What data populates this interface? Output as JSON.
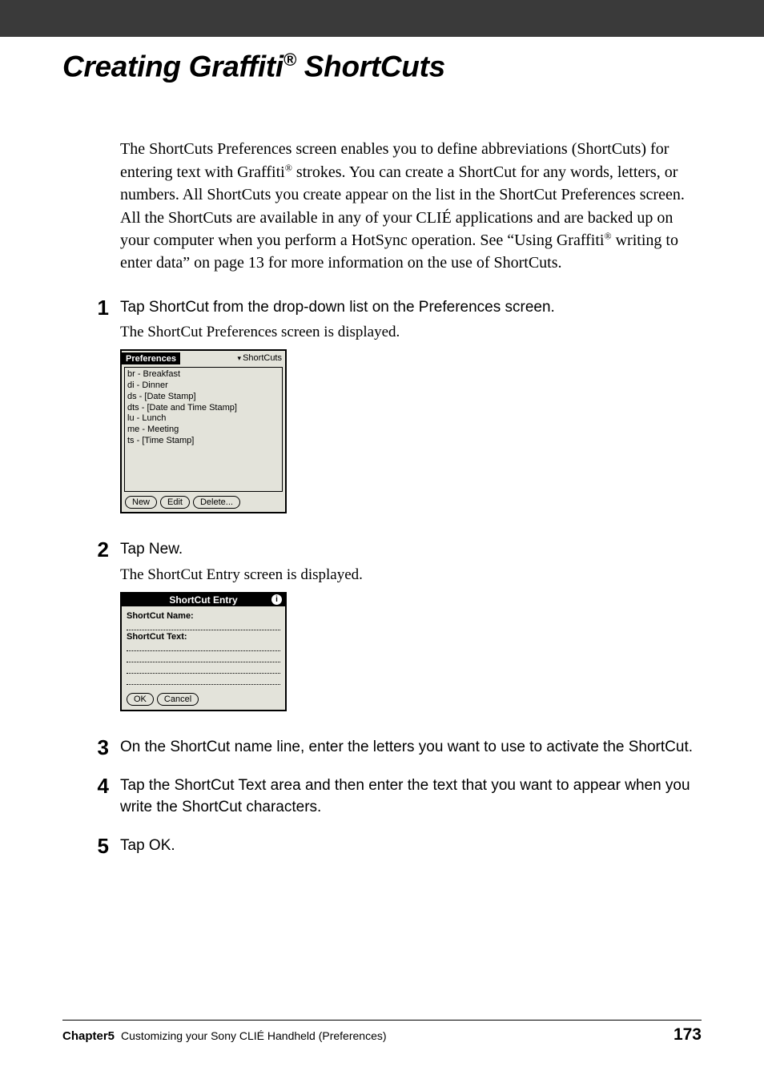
{
  "title": {
    "part1": "Creating Graffiti",
    "reg": "®",
    "part2": "ShortCuts"
  },
  "intro": {
    "t1": "The ShortCuts Preferences screen enables you to define abbreviations (ShortCuts) for entering text with Graffiti",
    "reg1": "®",
    "t2": " strokes. You can create a ShortCut for any words, letters, or numbers. All ShortCuts you create appear on the list in the ShortCut Preferences screen. All the ShortCuts are available in any of your CLIÉ applications and are backed up on your computer when you perform a HotSync operation. See “Using Graffiti",
    "reg2": "®",
    "t3": " writing to enter data” on page 13 for more information on the use of ShortCuts."
  },
  "steps": [
    {
      "num": "1",
      "instr": "Tap ShortCut from the drop-down list on the Preferences screen.",
      "sub": "The ShortCut Preferences screen is displayed."
    },
    {
      "num": "2",
      "instr": "Tap New.",
      "sub": "The ShortCut Entry screen is displayed."
    },
    {
      "num": "3",
      "instr": "On the ShortCut name line, enter the letters you want to use to activate the ShortCut."
    },
    {
      "num": "4",
      "instr": "Tap the ShortCut Text area and then enter the text that you want to appear when you write the ShortCut characters."
    },
    {
      "num": "5",
      "instr": "Tap OK."
    }
  ],
  "palm1": {
    "title": "Preferences",
    "dropdown": "ShortCuts",
    "items": [
      "br - Breakfast",
      "di - Dinner",
      "ds - [Date Stamp]",
      "dts - [Date and Time Stamp]",
      "lu - Lunch",
      "me - Meeting",
      "ts - [Time Stamp]"
    ],
    "buttons": [
      "New",
      "Edit",
      "Delete..."
    ]
  },
  "palm2": {
    "title": "ShortCut Entry",
    "info": "i",
    "label1": "ShortCut Name:",
    "label2": "ShortCut Text:",
    "buttons": [
      "OK",
      "Cancel"
    ]
  },
  "footer": {
    "chapter": "Chapter5",
    "text": "Customizing your Sony CLIÉ Handheld (Preferences)",
    "page": "173"
  }
}
